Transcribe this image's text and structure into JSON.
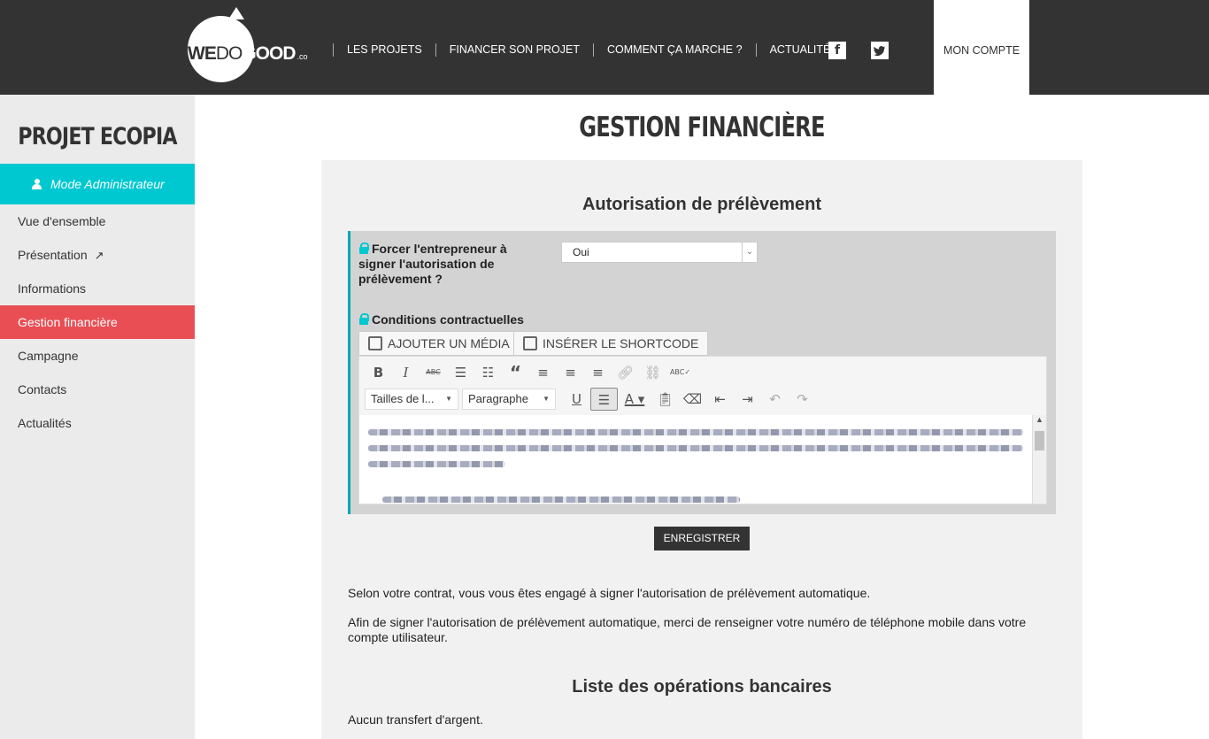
{
  "header": {
    "logo": {
      "we": "WE",
      "do": "DO",
      "good": "GOOD",
      "co": ".co"
    },
    "nav": [
      "LES PROJETS",
      "FINANCER SON PROJET",
      "COMMENT ÇA MARCHE ?",
      "ACTUALITÉS"
    ],
    "social": {
      "facebook": "f",
      "twitter": "t"
    },
    "account": "MON COMPTE"
  },
  "sidebar": {
    "project_title": "PROJET ECOPIA",
    "admin_mode": "Mode Administrateur",
    "items": [
      {
        "label": "Vue d'ensemble"
      },
      {
        "label": "Présentation"
      },
      {
        "label": "Informations"
      },
      {
        "label": "Gestion financière",
        "active": true
      },
      {
        "label": "Campagne"
      },
      {
        "label": "Contacts"
      },
      {
        "label": "Actualités"
      }
    ]
  },
  "main": {
    "page_title": "GESTION FINANCIÈRE",
    "section1_title": "Autorisation de prélèvement",
    "force_label": "Forcer l'entrepreneur à signer l'autorisation de prélèvement ?",
    "force_value": "Oui",
    "conditions_label": "Conditions contractuelles",
    "add_media": "AJOUTER UN MÉDIA",
    "insert_shortcode": "INSÉRER LE SHORTCODE",
    "font_size_select": "Tailles de l...",
    "format_select": "Paragraphe",
    "save_button": "ENREGISTRER",
    "para1": "Selon votre contrat, vous vous êtes engagé à signer l'autorisation de prélèvement automatique.",
    "para2": "Afin de signer l'autorisation de prélèvement automatique, merci de renseigner votre numéro de téléphone mobile dans votre compte utilisateur.",
    "section2_title": "Liste des opérations bancaires",
    "no_transfer": "Aucun transfert d'argent."
  },
  "colors": {
    "header_bg": "#333333",
    "accent_cyan": "#00c8d0",
    "active_red": "#e94e54",
    "sidebar_bg": "#ebebeb",
    "panel_bg": "#f1f1f1"
  }
}
